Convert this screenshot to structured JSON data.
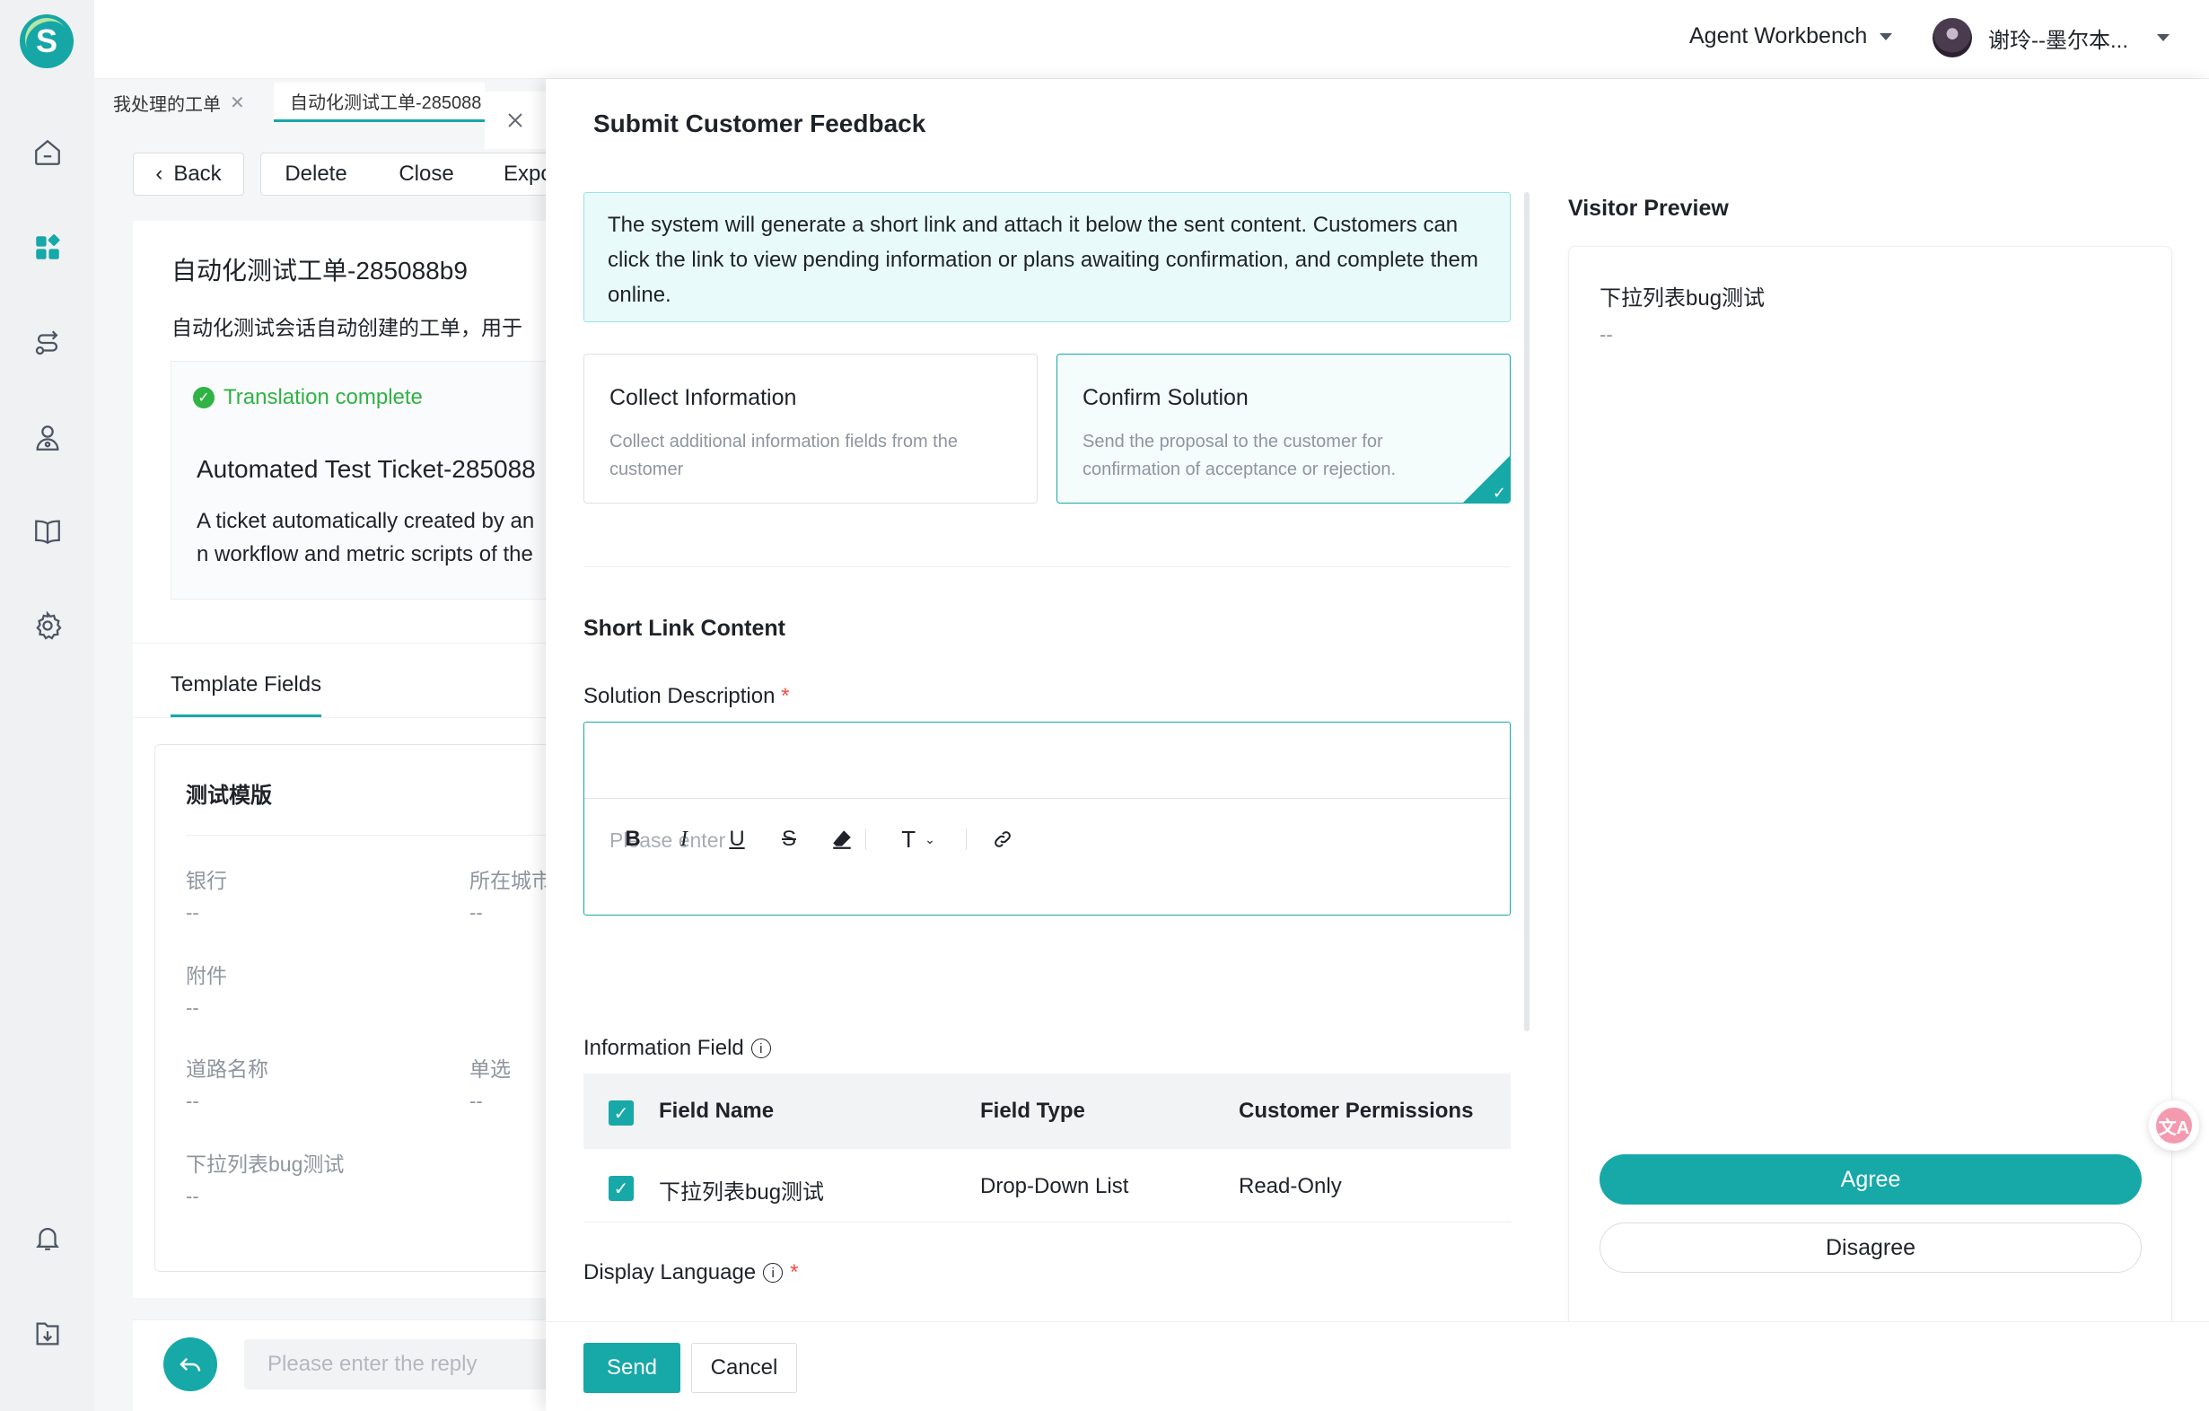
{
  "app": {
    "logo_letter": "S",
    "workspace_label": "Agent Workbench",
    "user_name": "谢玲--墨尔本..."
  },
  "rail": {
    "icons": [
      "home-icon",
      "dashboard-icon",
      "routing-icon",
      "users-icon",
      "book-icon",
      "settings-icon",
      "bell-icon",
      "download-icon"
    ]
  },
  "tabs": [
    {
      "label": "我处理的工单"
    },
    {
      "label": "自动化测试工单-285088"
    }
  ],
  "toolbar": {
    "back": "Back",
    "delete": "Delete",
    "close": "Close",
    "export": "Expo"
  },
  "ticket": {
    "title": "自动化测试工单-285088b9",
    "description": "自动化测试会话自动创建的工单，用于",
    "translation_status": "Translation complete",
    "translated_title": "Automated Test Ticket-285088",
    "translated_desc_1": "A ticket automatically created by an",
    "translated_desc_2": "n workflow and metric scripts of the"
  },
  "template": {
    "tab_label": "Template Fields",
    "card_title": "测试模版",
    "fields": [
      {
        "label": "银行",
        "value": "--"
      },
      {
        "label": "所在城市",
        "value": "--"
      },
      {
        "label": "附件",
        "value": "--"
      },
      {
        "label": "道路名称",
        "value": "--"
      },
      {
        "label": "单选",
        "value": "--"
      },
      {
        "label": "下拉列表bug测试",
        "value": "--"
      }
    ]
  },
  "reply": {
    "placeholder": "Please enter the reply"
  },
  "drawer": {
    "title": "Submit Customer Feedback",
    "info": "The system will generate a short link and attach it below the sent content. Customers can click the link to view pending information or plans awaiting confirmation, and complete them online.",
    "options": [
      {
        "title": "Collect Information",
        "desc": "Collect additional information fields from the customer"
      },
      {
        "title": "Confirm Solution",
        "desc": "Send the proposal to the customer for confirmation of acceptance or rejection."
      }
    ],
    "section_title": "Short Link Content",
    "solution_label": "Solution Description",
    "editor_placeholder": "Please enter",
    "info_field_label": "Information Field",
    "table": {
      "headers": [
        "Field Name",
        "Field Type",
        "Customer Permissions"
      ],
      "rows": [
        {
          "name": "下拉列表bug测试",
          "type": "Drop-Down List",
          "permission": "Read-Only"
        }
      ]
    },
    "display_language_label": "Display Language",
    "required_mark": "*",
    "send": "Send",
    "cancel": "Cancel"
  },
  "preview": {
    "title": "Visitor Preview",
    "field_name": "下拉列表bug测试",
    "field_value": "--",
    "agree": "Agree",
    "disagree": "Disagree"
  },
  "colors": {
    "accent": "#17a8a8",
    "accent_light": "#e8fafa",
    "required": "#f54a45",
    "success": "#2fb344"
  }
}
